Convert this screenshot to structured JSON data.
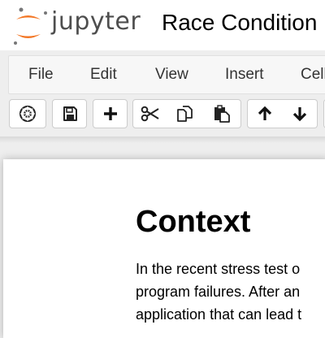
{
  "header": {
    "logo_text": "jupyter",
    "notebook_title": "Race Condition"
  },
  "menu": {
    "items": [
      "File",
      "Edit",
      "View",
      "Insert",
      "Cell"
    ]
  },
  "toolbar": {
    "buttons": [
      {
        "name": "save-and-checkpoint-button",
        "icon": "save-icon"
      },
      {
        "name": "add-cell-button",
        "icon": "plus-icon"
      },
      {
        "name": "cut-button",
        "icon": "scissors-icon"
      },
      {
        "name": "copy-button",
        "icon": "copy-icon"
      },
      {
        "name": "paste-button",
        "icon": "paste-icon"
      },
      {
        "name": "move-up-button",
        "icon": "arrow-up-icon"
      },
      {
        "name": "move-down-button",
        "icon": "arrow-down-icon"
      }
    ]
  },
  "cell": {
    "heading": "Context",
    "lines": [
      "In the recent stress test o",
      "program failures. After an",
      "application that can lead t"
    ]
  },
  "colors": {
    "logo_orange": "#f37726",
    "logo_gray": "#767677"
  }
}
